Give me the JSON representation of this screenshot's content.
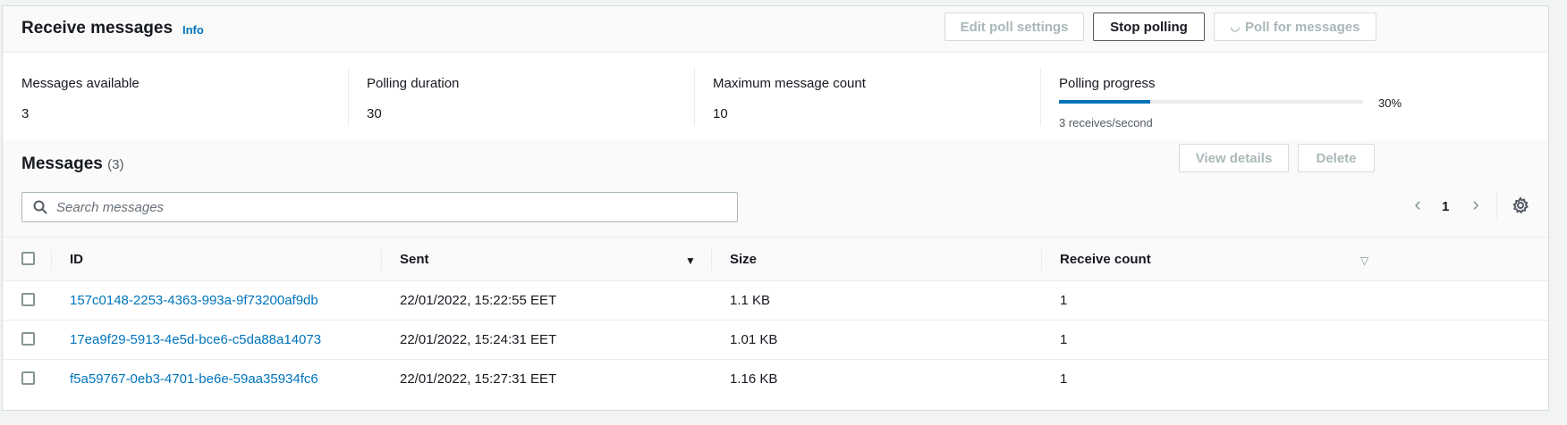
{
  "header": {
    "title": "Receive messages",
    "info": "Info",
    "edit_poll_settings": "Edit poll settings",
    "stop_polling": "Stop polling",
    "poll_for_messages": "Poll for messages"
  },
  "stats": {
    "messages_available_label": "Messages available",
    "messages_available": "3",
    "polling_duration_label": "Polling duration",
    "polling_duration": "30",
    "max_message_count_label": "Maximum message count",
    "max_message_count": "10",
    "polling_progress_label": "Polling progress",
    "polling_progress_percent": 30,
    "polling_progress_text": "30%",
    "receives_per_second": "3 receives/second"
  },
  "messages": {
    "title": "Messages",
    "count": "(3)",
    "view_details": "View details",
    "delete": "Delete",
    "search_placeholder": "Search messages",
    "page": "1"
  },
  "table": {
    "columns": {
      "id": "ID",
      "sent": "Sent",
      "size": "Size",
      "receive_count": "Receive count"
    },
    "rows": [
      {
        "id": "157c0148-2253-4363-993a-9f73200af9db",
        "sent": "22/01/2022, 15:22:55 EET",
        "size": "1.1 KB",
        "receive_count": "1"
      },
      {
        "id": "17ea9f29-5913-4e5d-bce6-c5da88a14073",
        "sent": "22/01/2022, 15:24:31 EET",
        "size": "1.01 KB",
        "receive_count": "1"
      },
      {
        "id": "f5a59767-0eb3-4701-be6e-59aa35934fc6",
        "sent": "22/01/2022, 15:27:31 EET",
        "size": "1.16 KB",
        "receive_count": "1"
      }
    ]
  },
  "colors": {
    "accent": "#0073bb",
    "link": "#0073bb",
    "disabled": "#aab7b8"
  }
}
